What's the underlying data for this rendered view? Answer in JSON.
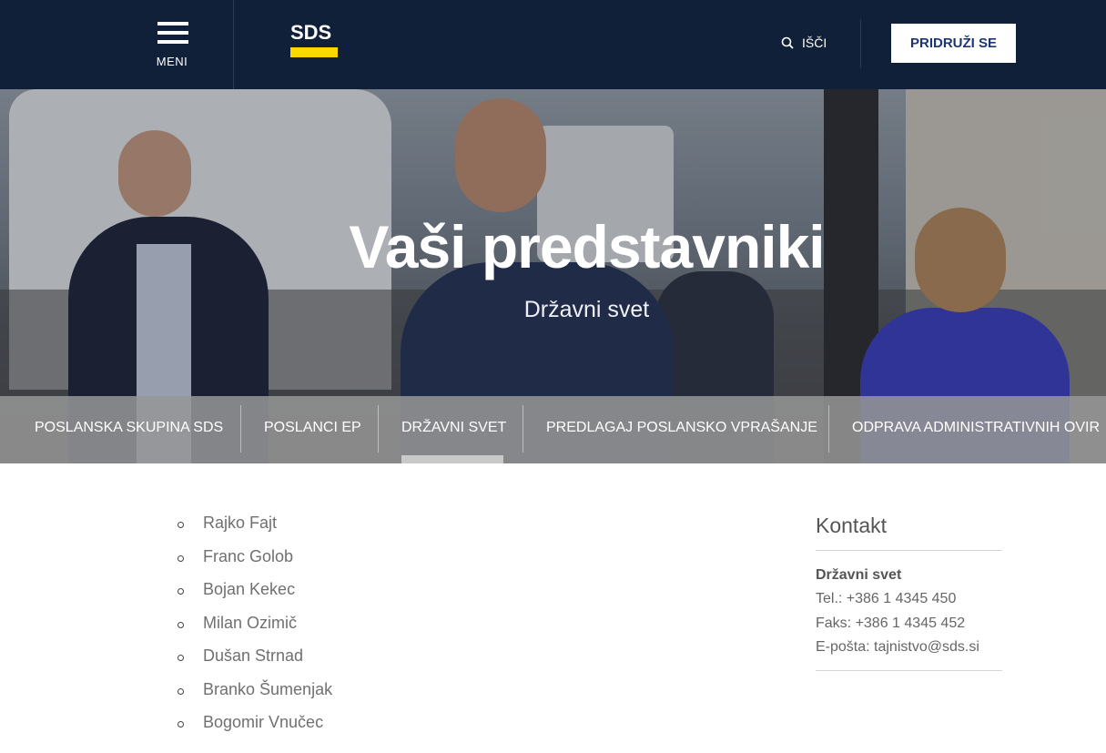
{
  "header": {
    "menu_label": "MENI",
    "logo_text": "SDS",
    "search_label": "IŠČI",
    "join_label": "PRIDRUŽI SE"
  },
  "hero": {
    "title": "Vaši predstavniki",
    "subtitle": "Državni svet"
  },
  "subnav": {
    "items": [
      {
        "label": "POSLANSKA SKUPINA SDS"
      },
      {
        "label": "POSLANCI EP"
      },
      {
        "label": "DRŽAVNI SVET",
        "active": true
      },
      {
        "label": "PREDLAGAJ POSLANSKO VPRAŠANJE"
      },
      {
        "label": "ODPRAVA ADMINISTRATIVNIH OVIR"
      }
    ]
  },
  "representatives": [
    "Rajko Fajt",
    "Franc Golob",
    "Bojan Kekec",
    "Milan Ozimič",
    "Dušan Strnad",
    "Branko Šumenjak",
    "Bogomir Vnučec"
  ],
  "contact": {
    "heading": "Kontakt",
    "org": "Državni svet",
    "phone": "Tel.: +386 1 4345 450",
    "fax": "Faks: +386 1 4345 452",
    "email": "E-pošta: tajnistvo@sds.si"
  },
  "colors": {
    "header_bg": "#0f2038",
    "logo_stripe": "#ffd800",
    "join_text": "#1b3673",
    "subnav_bg": "#969696"
  }
}
